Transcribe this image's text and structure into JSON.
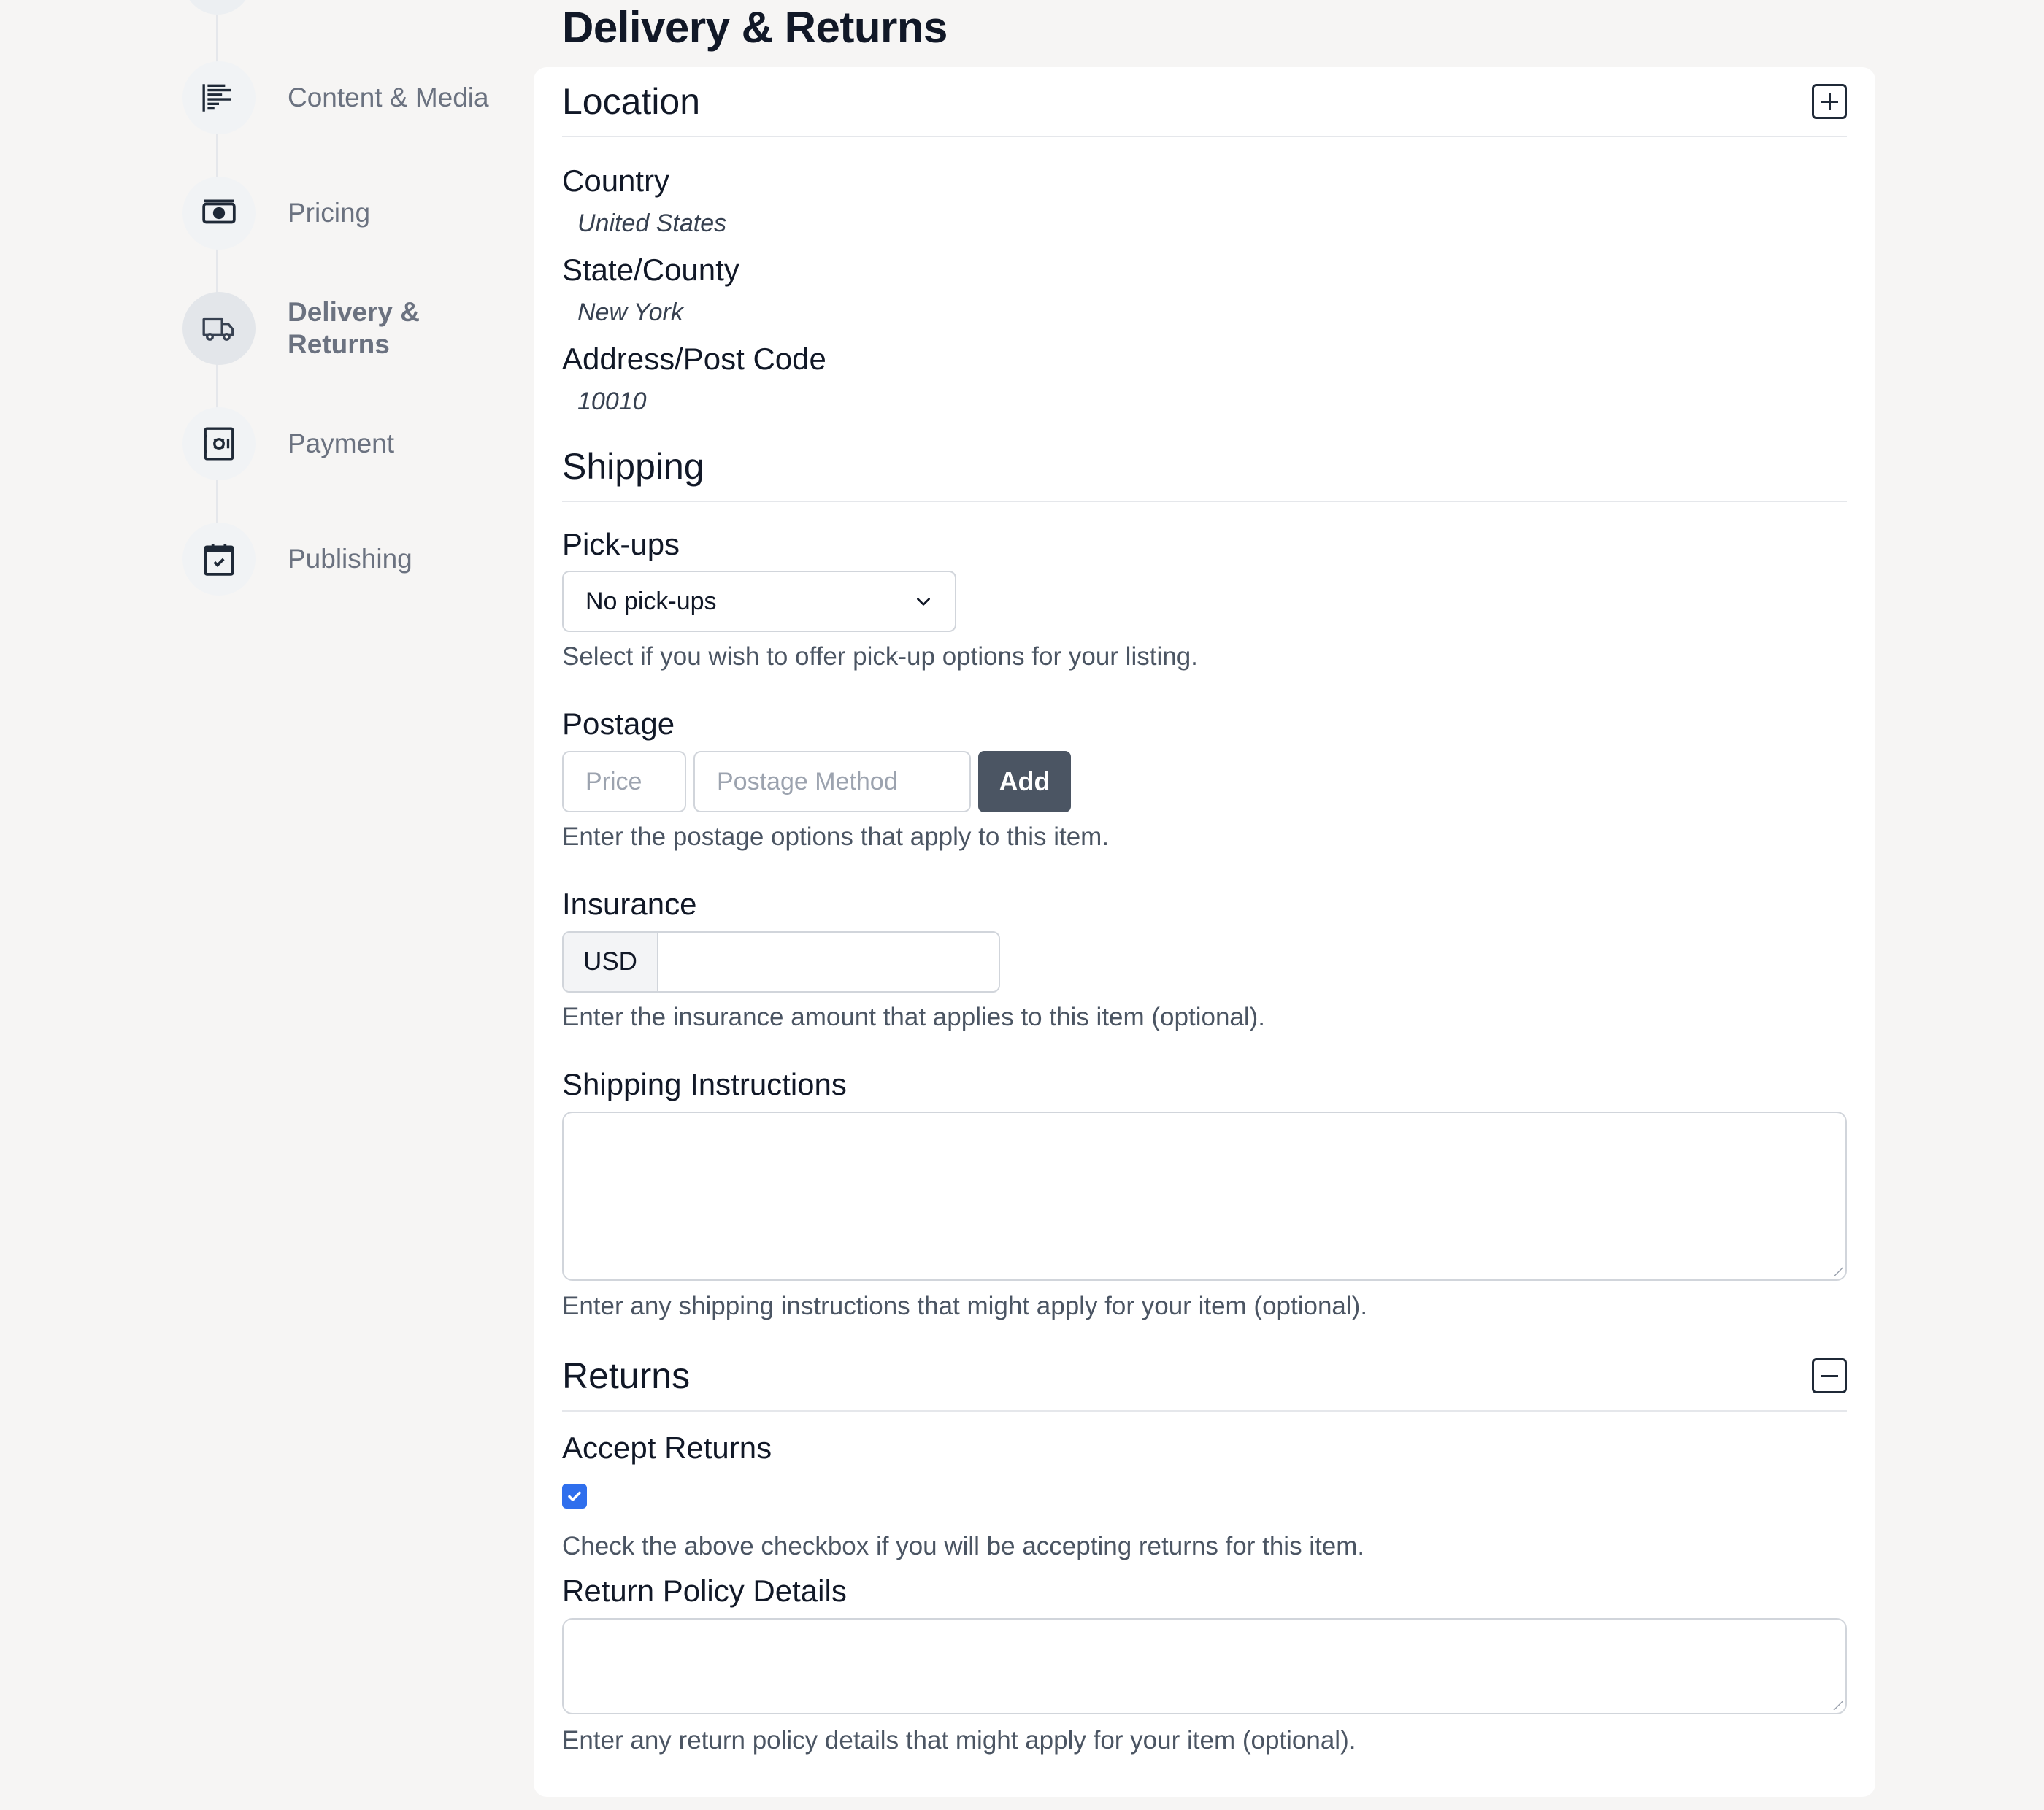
{
  "stepper": {
    "steps": [
      {
        "label": "Content & Media",
        "icon": "content-media-icon",
        "active": false
      },
      {
        "label": "Pricing",
        "icon": "pricing-icon",
        "active": false
      },
      {
        "label": "Delivery & Returns",
        "icon": "truck-icon",
        "active": true
      },
      {
        "label": "Payment",
        "icon": "payment-icon",
        "active": false
      },
      {
        "label": "Publishing",
        "icon": "calendar-check-icon",
        "active": false
      }
    ]
  },
  "page": {
    "title": "Delivery & Returns"
  },
  "location": {
    "title": "Location",
    "country_label": "Country",
    "country_value": "United States",
    "state_label": "State/County",
    "state_value": "New York",
    "address_label": "Address/Post Code",
    "address_value": "10010"
  },
  "shipping": {
    "title": "Shipping",
    "pickups_label": "Pick-ups",
    "pickups_selected": "No pick-ups",
    "pickups_help": "Select if you wish to offer pick-up options for your listing.",
    "postage_label": "Postage",
    "price_placeholder": "Price",
    "method_placeholder": "Postage Method",
    "add_label": "Add",
    "postage_help": "Enter the postage options that apply to this item.",
    "insurance_label": "Insurance",
    "insurance_currency": "USD",
    "insurance_value": "",
    "insurance_help": "Enter the insurance amount that applies to this item (optional).",
    "instructions_label": "Shipping Instructions",
    "instructions_value": "",
    "instructions_help": "Enter any shipping instructions that might apply for your item (optional)."
  },
  "returns": {
    "title": "Returns",
    "accept_label": "Accept Returns",
    "accept_checked": true,
    "accept_help": "Check the above checkbox if you will be accepting returns for this item.",
    "policy_label": "Return Policy Details",
    "policy_value": "",
    "policy_help": "Enter any return policy details that might apply for your item (optional)."
  },
  "colors": {
    "accent": "#2f6fed",
    "button": "#4b5563",
    "background": "#f6f5f4"
  }
}
